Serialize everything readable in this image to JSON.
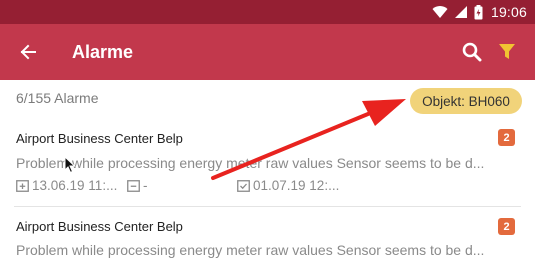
{
  "statusbar": {
    "time": "19:06"
  },
  "toolbar": {
    "title": "Alarme"
  },
  "list": {
    "count_label": "6/155 Alarme",
    "filter_chip": "Objekt: BH060",
    "items": [
      {
        "name": "Airport Business Center Belp",
        "badge": "2",
        "description": "Problem while processing energy meter raw values Sensor seems to be d...",
        "start": "13.06.19 11:...",
        "end": "-",
        "done": "01.07.19 12:..."
      },
      {
        "name": "Airport Business Center Belp",
        "badge": "2",
        "description": "Problem while processing energy meter raw values Sensor seems to be d..."
      }
    ]
  },
  "colors": {
    "statusbar": "#951f33",
    "toolbar": "#c2384c",
    "chip": "#f1d37a",
    "badge": "#e36a3d",
    "arrow": "#e8231f"
  }
}
